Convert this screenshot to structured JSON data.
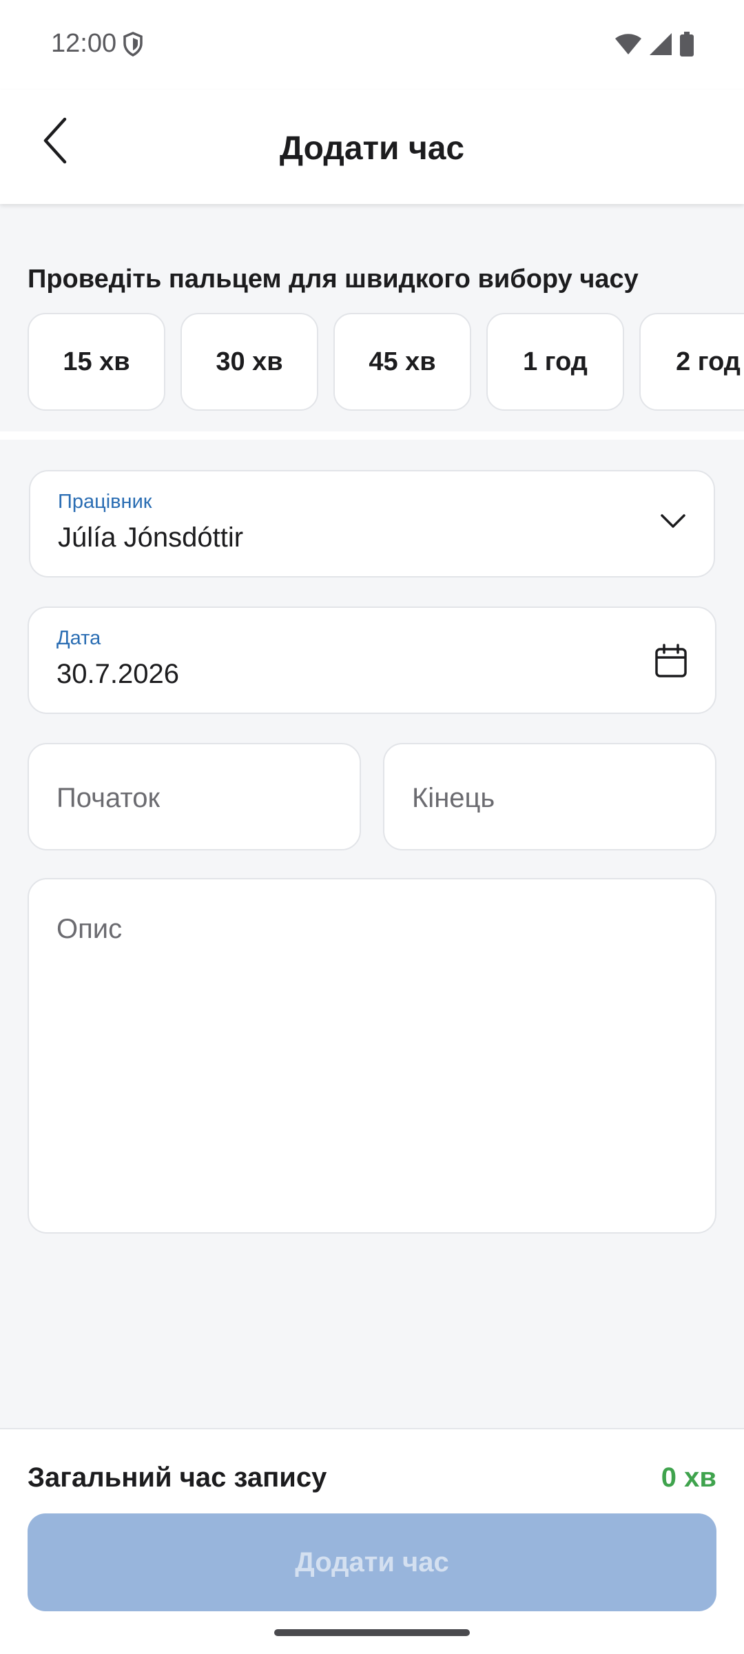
{
  "status_bar": {
    "time": "12:00",
    "icons": [
      "shield-icon",
      "wifi-icon",
      "signal-icon",
      "battery-icon"
    ]
  },
  "app_bar": {
    "title": "Додати час",
    "back_icon": "chevron-left-icon"
  },
  "quick_select": {
    "hint": "Проведіть пальцем для швидкого вибору часу",
    "chips": [
      "15 хв",
      "30 хв",
      "45 хв",
      "1 год",
      "2 год"
    ]
  },
  "form": {
    "employee": {
      "label": "Працівник",
      "value": "Júlía Jónsdóttir",
      "icon": "chevron-down-icon"
    },
    "date": {
      "label": "Дата",
      "value": "30.7.2026",
      "icon": "calendar-icon"
    },
    "start": {
      "placeholder": "Початок"
    },
    "end": {
      "placeholder": "Кінець"
    },
    "description": {
      "placeholder": "Опис"
    }
  },
  "summary": {
    "total_label": "Загальний час запису",
    "total_value": "0 хв",
    "submit_label": "Додати час"
  },
  "colors": {
    "accent_label": "#2a6db3",
    "total_green": "#3fa34d",
    "button_disabled": "#98b5dc",
    "background": "#f5f6f8"
  }
}
